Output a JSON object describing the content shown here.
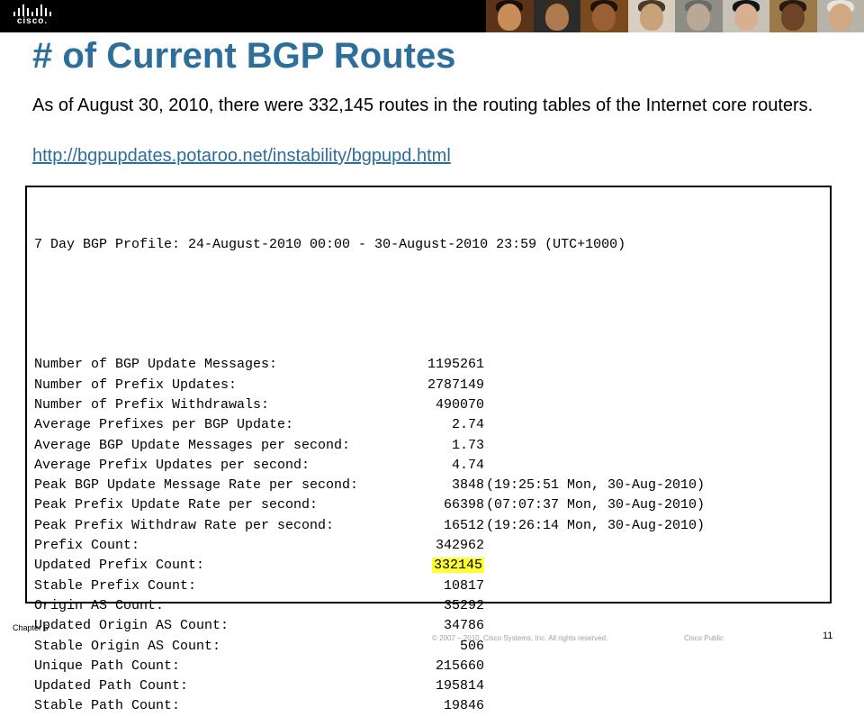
{
  "brand": {
    "logo_text": "cisco."
  },
  "slide": {
    "title": "# of Current BGP Routes",
    "paragraph": "As of August 30, 2010, there were 332,145 routes in the routing tables of the Internet core routers.",
    "link": "http://bgpupdates.potaroo.net/instability/bgpupd.html"
  },
  "terminal": {
    "header": "7 Day BGP Profile: 24-August-2010 00:00 - 30-August-2010 23:59 (UTC+1000)",
    "rows": [
      {
        "label": "Number of BGP Update Messages:",
        "value": "1195261",
        "extra": ""
      },
      {
        "label": "Number of Prefix Updates:",
        "value": "2787149",
        "extra": ""
      },
      {
        "label": "Number of Prefix Withdrawals:",
        "value": "490070",
        "extra": ""
      },
      {
        "label": "Average Prefixes per BGP Update:",
        "value": "2.74",
        "extra": ""
      },
      {
        "label": "Average BGP Update Messages per second:",
        "value": "1.73",
        "extra": ""
      },
      {
        "label": "Average Prefix Updates per second:",
        "value": "4.74",
        "extra": ""
      },
      {
        "label": "Peak BGP Update Message Rate per second:",
        "value": "3848",
        "extra": "(19:25:51 Mon, 30-Aug-2010)"
      },
      {
        "label": "Peak Prefix Update Rate per second:",
        "value": "66398",
        "extra": "(07:07:37 Mon, 30-Aug-2010)"
      },
      {
        "label": "Peak Prefix Withdraw Rate per second:",
        "value": "16512",
        "extra": "(19:26:14 Mon, 30-Aug-2010)"
      },
      {
        "label": "Prefix Count:",
        "value": "342962",
        "extra": ""
      },
      {
        "label": "Updated Prefix Count:",
        "value": "332145",
        "extra": "",
        "highlight": true
      },
      {
        "label": "Stable Prefix Count:",
        "value": "10817",
        "extra": ""
      },
      {
        "label": "Origin AS Count:",
        "value": "35292",
        "extra": ""
      },
      {
        "label": "Updated Origin AS Count:",
        "value": "34786",
        "extra": ""
      },
      {
        "label": "Stable Origin AS Count:",
        "value": "506",
        "extra": ""
      },
      {
        "label": "Unique Path Count:",
        "value": "215660",
        "extra": ""
      },
      {
        "label": "Updated Path Count:",
        "value": "195814",
        "extra": ""
      },
      {
        "label": "Stable Path Count:",
        "value": "19846",
        "extra": ""
      }
    ]
  },
  "footer": {
    "chapter": "Chapter 6",
    "copyright": "© 2007 – 2010, Cisco Systems, Inc. All rights reserved.",
    "classification": "Cisco Public",
    "page": "11"
  },
  "colors": {
    "title": "#2e6e9b",
    "highlight": "#ffff33",
    "banner": "#000000"
  }
}
